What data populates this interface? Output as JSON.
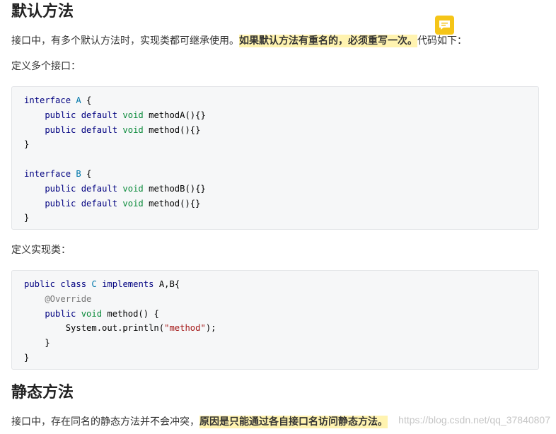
{
  "section1": {
    "title": "默认方法",
    "para1_text": "接口中，有多个默认方法时，实现类都可继承使用。",
    "para1_highlight": "如果默认方法有重名的，必须重写一次。",
    "para1_tail": "代码如下：",
    "label_define_interfaces": "定义多个接口：",
    "code_interfaces": [
      [
        {
          "t": "interface ",
          "c": "kw"
        },
        {
          "t": "A",
          "c": "ty"
        },
        {
          "t": " {",
          "c": "fn"
        }
      ],
      [
        {
          "t": "    public ",
          "c": "kw"
        },
        {
          "t": "default ",
          "c": "kw"
        },
        {
          "t": "void ",
          "c": "gr"
        },
        {
          "t": "methodA(){}",
          "c": "fn"
        }
      ],
      [
        {
          "t": "    public ",
          "c": "kw"
        },
        {
          "t": "default ",
          "c": "kw"
        },
        {
          "t": "void ",
          "c": "gr"
        },
        {
          "t": "method(){}",
          "c": "fn"
        }
      ],
      [
        {
          "t": "}",
          "c": "fn"
        }
      ],
      [],
      [
        {
          "t": "interface ",
          "c": "kw"
        },
        {
          "t": "B",
          "c": "ty"
        },
        {
          "t": " {",
          "c": "fn"
        }
      ],
      [
        {
          "t": "    public ",
          "c": "kw"
        },
        {
          "t": "default ",
          "c": "kw"
        },
        {
          "t": "void ",
          "c": "gr"
        },
        {
          "t": "methodB(){}",
          "c": "fn"
        }
      ],
      [
        {
          "t": "    public ",
          "c": "kw"
        },
        {
          "t": "default ",
          "c": "kw"
        },
        {
          "t": "void ",
          "c": "gr"
        },
        {
          "t": "method(){}",
          "c": "fn"
        }
      ],
      [
        {
          "t": "}",
          "c": "fn"
        }
      ]
    ],
    "label_define_impl": "定义实现类：",
    "code_impl": [
      [
        {
          "t": "public ",
          "c": "kw"
        },
        {
          "t": "class ",
          "c": "kw"
        },
        {
          "t": "C ",
          "c": "ty"
        },
        {
          "t": "implements ",
          "c": "kw"
        },
        {
          "t": "A,B{",
          "c": "fn"
        }
      ],
      [
        {
          "t": "    @Override",
          "c": "an"
        }
      ],
      [
        {
          "t": "    public ",
          "c": "kw"
        },
        {
          "t": "void ",
          "c": "gr"
        },
        {
          "t": "method() {",
          "c": "fn"
        }
      ],
      [
        {
          "t": "        System.out.println(",
          "c": "fn"
        },
        {
          "t": "\"method\"",
          "c": "st"
        },
        {
          "t": ");",
          "c": "fn"
        }
      ],
      [
        {
          "t": "    }",
          "c": "fn"
        }
      ],
      [
        {
          "t": "}",
          "c": "fn"
        }
      ]
    ]
  },
  "section2": {
    "title": "静态方法",
    "para_text": "接口中，存在同名的静态方法并不会冲突，",
    "para_highlight": "原因是只能通过各自接口名访问静态方法。"
  },
  "comment_icon": "comment-icon",
  "watermark": "https://blog.csdn.net/qq_37840807",
  "colors": {
    "highlight": "#fff3b0",
    "badge": "#f5c518",
    "keyword": "#000080",
    "type": "#0077aa",
    "void": "#0a8a3a",
    "string": "#a31515"
  }
}
